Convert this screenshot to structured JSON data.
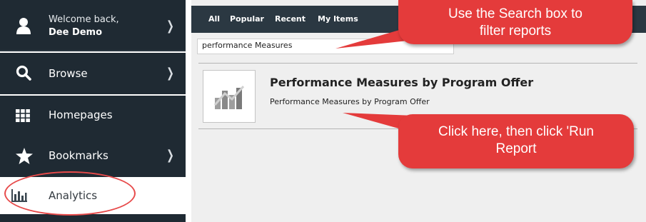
{
  "sidebar": {
    "user": {
      "welcome": "Welcome back,",
      "name": "Dee Demo"
    },
    "items": [
      {
        "label": "Browse",
        "icon": "search-icon"
      },
      {
        "label": "Homepages",
        "icon": "grid-icon"
      },
      {
        "label": "Bookmarks",
        "icon": "star-icon"
      },
      {
        "label": "Analytics",
        "icon": "bar-chart-icon"
      }
    ]
  },
  "main": {
    "tabs": [
      "All",
      "Popular",
      "Recent",
      "My Items"
    ],
    "search": {
      "value": "performance Measures"
    },
    "result": {
      "title": "Performance Measures by Program Offer",
      "description": "Performance Measures by Program Offer"
    }
  },
  "callouts": {
    "search_hint_line1": "Use the Search box to",
    "search_hint_line2": "filter reports",
    "click_hint_line1": "Click here, then click 'Run",
    "click_hint_line2": "Report"
  },
  "colors": {
    "sidebar_bg": "#1f2a33",
    "tabbar_bg": "#2b3842",
    "callout_red": "#e43b3b",
    "annotation_circle": "#e74a4a"
  }
}
